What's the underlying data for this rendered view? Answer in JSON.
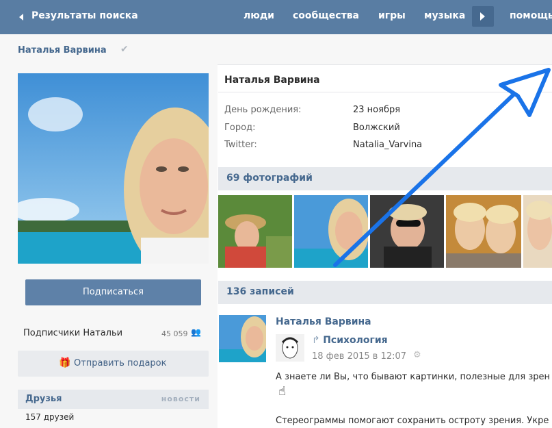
{
  "topbar": {
    "back_label": "Результаты поиска",
    "nav": [
      "люди",
      "сообщества",
      "игры",
      "музыка",
      "помощь"
    ]
  },
  "header": {
    "name": "Наталья Варвина"
  },
  "left": {
    "subscribe_label": "Подписаться",
    "followers_label": "Подписчики Натальи",
    "followers_count": "45 059",
    "gift_label": "Отправить подарок",
    "friends_title": "Друзья",
    "friends_news": "новости",
    "friends_count": "157 друзей"
  },
  "profile": {
    "name": "Наталья Варвина",
    "info": [
      {
        "label": "День рождения:",
        "value": "23 ноября"
      },
      {
        "label": "Город:",
        "value": "Волжский"
      },
      {
        "label": "Twitter:",
        "value": "Natalia_Varvina"
      }
    ]
  },
  "photos": {
    "title": "69 фотографий"
  },
  "posts": {
    "title": "136 записей",
    "author": "Наталья Варвина",
    "repost_source": "Психология",
    "date": "18 фев 2015 в 12:07",
    "text1": "А знаете ли Вы, что бывают картинки, полезные для зрен",
    "text2": "Стереограммы помогают сохранить остроту зрения. Укре"
  },
  "colors": {
    "topbar": "#597da3",
    "accent": "#45688e",
    "arrow": "#1a73e8",
    "button": "#5e81a8"
  }
}
